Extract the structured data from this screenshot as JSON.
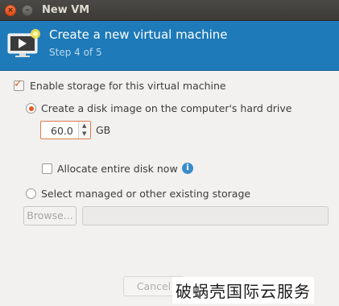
{
  "window": {
    "title": "New VM",
    "close_glyph": "×",
    "minimize_glyph": "–"
  },
  "header": {
    "title": "Create a new virtual machine",
    "step": "Step 4 of 5",
    "icon": "monitor-icon"
  },
  "storage": {
    "enable_label": "Enable storage for this virtual machine",
    "enable_checked": true,
    "create_disk_label": "Create a disk image on the computer's hard drive",
    "create_disk_selected": true,
    "size_value": "60.0",
    "size_unit": "GB",
    "allocate_label": "Allocate entire disk now",
    "allocate_checked": false,
    "managed_label": "Select managed or other existing storage",
    "managed_selected": false,
    "browse_label": "Browse...",
    "path_value": ""
  },
  "footer": {
    "cancel_label": "Cancel"
  },
  "watermark": {
    "text": "破蜗壳国际云服务"
  },
  "colors": {
    "header_bg": "#1e7ab8",
    "accent": "#df5920",
    "titlebar": "#3c3b37"
  }
}
